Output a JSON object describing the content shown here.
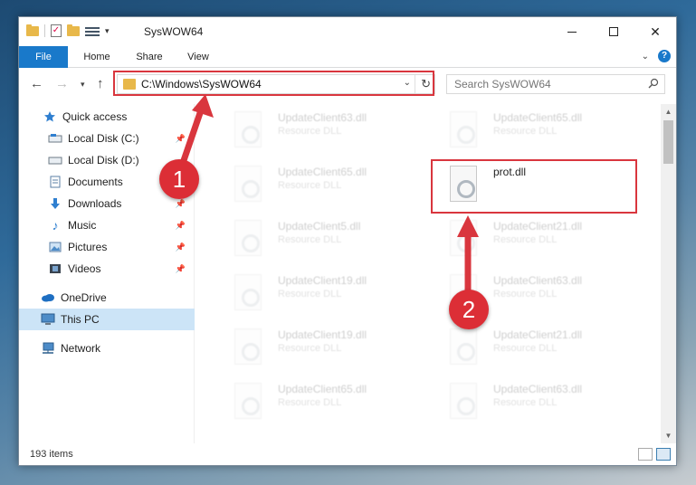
{
  "window": {
    "title": "SysWOW64",
    "quick_access_dropdown": "▾"
  },
  "ribbon": {
    "tabs": [
      "File",
      "Home",
      "Share",
      "View"
    ]
  },
  "address_bar": {
    "path": "C:\\Windows\\SysWOW64"
  },
  "search": {
    "placeholder": "Search SysWOW64"
  },
  "sidebar": {
    "items": [
      {
        "label": "Quick access",
        "icon": "star-icon",
        "pinned": false
      },
      {
        "label": "Local Disk (C:)",
        "icon": "drive-icon",
        "pinned": true
      },
      {
        "label": "Local Disk (D:)",
        "icon": "drive-icon",
        "pinned": false
      },
      {
        "label": "Documents",
        "icon": "documents-icon",
        "pinned": true
      },
      {
        "label": "Downloads",
        "icon": "download-icon",
        "pinned": true
      },
      {
        "label": "Music",
        "icon": "music-icon",
        "pinned": true
      },
      {
        "label": "Pictures",
        "icon": "pictures-icon",
        "pinned": true
      },
      {
        "label": "Videos",
        "icon": "videos-icon",
        "pinned": true
      },
      {
        "label": "OneDrive",
        "icon": "cloud-icon",
        "pinned": false
      },
      {
        "label": "This PC",
        "icon": "computer-icon",
        "pinned": false,
        "selected": true
      },
      {
        "label": "Network",
        "icon": "network-icon",
        "pinned": false
      }
    ]
  },
  "files": {
    "left_column": [
      {
        "name": "UpdateClient63.dll",
        "type": "Resource DLL"
      },
      {
        "name": "UpdateClient65.dll",
        "type": "Resource DLL"
      },
      {
        "name": "UpdateClient5.dll",
        "type": "Resource DLL"
      },
      {
        "name": "UpdateClient19.dll",
        "type": "Resource DLL"
      },
      {
        "name": "UpdateClient19.dll",
        "type": "Resource DLL"
      },
      {
        "name": "UpdateClient65.dll",
        "type": "Resource DLL"
      }
    ],
    "right_column": [
      {
        "name": "UpdateClient65.dll",
        "type": "Resource DLL"
      },
      {
        "name": "prot.dll",
        "type": "",
        "highlighted": true
      },
      {
        "name": "UpdateClient21.dll",
        "type": "Resource DLL"
      },
      {
        "name": "UpdateClient63.dll",
        "type": "Resource DLL"
      },
      {
        "name": "UpdateClient21.dll",
        "type": "Resource DLL"
      },
      {
        "name": "UpdateClient63.dll",
        "type": "Resource DLL"
      }
    ]
  },
  "status": {
    "item_count": "193 items"
  },
  "annotations": {
    "step1": "1",
    "step2": "2",
    "color": "#d9363e"
  }
}
